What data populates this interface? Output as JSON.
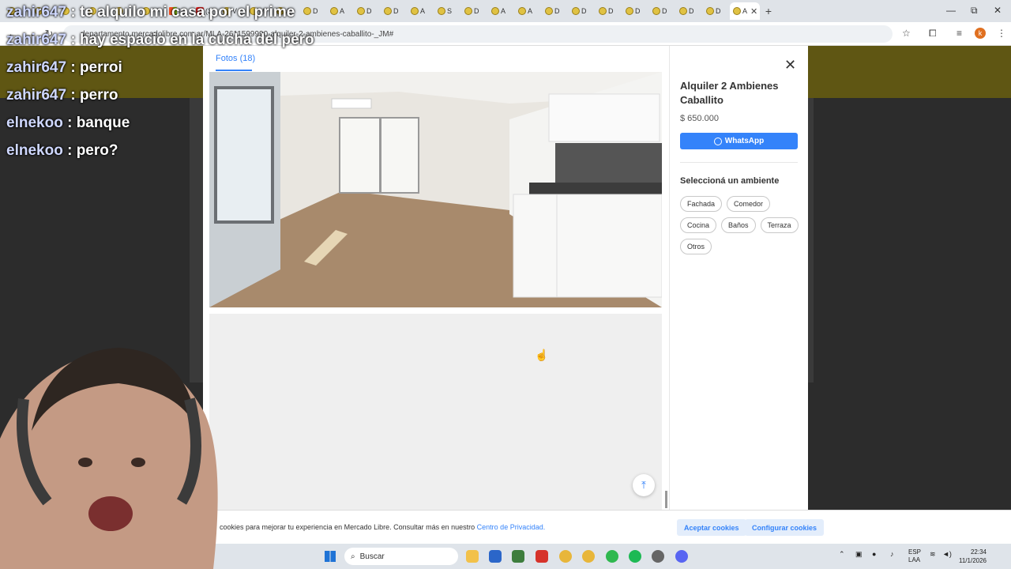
{
  "browser": {
    "tabs": [
      {
        "label": "",
        "type": "fav"
      },
      {
        "label": "",
        "type": "fav"
      },
      {
        "label": "",
        "type": "fav"
      },
      {
        "label": "",
        "type": "fav"
      },
      {
        "label": "",
        "type": "fav"
      },
      {
        "label": "",
        "type": "fav"
      },
      {
        "label": "U",
        "type": "ms"
      },
      {
        "label": "(3",
        "type": "yt"
      },
      {
        "label": "V",
        "type": "fav"
      },
      {
        "label": "M",
        "type": "fav"
      },
      {
        "label": "A",
        "type": "fav"
      },
      {
        "label": "D",
        "type": "fav"
      },
      {
        "label": "A",
        "type": "fav"
      },
      {
        "label": "D",
        "type": "fav"
      },
      {
        "label": "D",
        "type": "fav"
      },
      {
        "label": "A",
        "type": "fav"
      },
      {
        "label": "S",
        "type": "fav"
      },
      {
        "label": "D",
        "type": "fav"
      },
      {
        "label": "A",
        "type": "fav"
      },
      {
        "label": "A",
        "type": "fav"
      },
      {
        "label": "D",
        "type": "fav"
      },
      {
        "label": "D",
        "type": "fav"
      },
      {
        "label": "D",
        "type": "fav"
      },
      {
        "label": "D",
        "type": "fav"
      },
      {
        "label": "D",
        "type": "fav"
      },
      {
        "label": "D",
        "type": "fav"
      },
      {
        "label": "D",
        "type": "fav"
      },
      {
        "label": "A",
        "type": "active"
      }
    ],
    "url": "departamento.mercadolibre.com.ar/MLA-2611599990-alquiler-2-ambienes-caballito-_JM#",
    "profile_initial": "k"
  },
  "chat": [
    {
      "user": "zahir647",
      "message": "te alquilo mi casa por el prime"
    },
    {
      "user": "zahir647",
      "message": "hay espacio en la cucha del pero"
    },
    {
      "user": "zahir647",
      "message": "perroi"
    },
    {
      "user": "zahir647",
      "message": "perro"
    },
    {
      "user": "elnekoo",
      "message": "banque"
    },
    {
      "user": "elnekoo",
      "message": "pero?"
    }
  ],
  "modal": {
    "photos_tab": "Fotos (18)",
    "title": "Alquiler 2 Ambienes Caballito",
    "price": "$ 650.000",
    "whatsapp_label": "WhatsApp",
    "section_title": "Seleccioná un ambiente",
    "chips": [
      "Fachada",
      "Comedor",
      "Cocina",
      "Baños",
      "Terraza",
      "Otros"
    ]
  },
  "cookies": {
    "text": "cookies para mejorar tu experiencia en Mercado Libre. Consultar más en nuestro ",
    "link": "Centro de Privacidad.",
    "accept": "Aceptar cookies",
    "configure": "Configurar cookies"
  },
  "taskbar": {
    "search_placeholder": "Buscar",
    "lang": "ESP",
    "lang_sub": "LAA",
    "time": "22:34",
    "date": "11/1/2026"
  },
  "colors": {
    "accent": "#3483fa",
    "page_dim": "#2c2c2c"
  }
}
